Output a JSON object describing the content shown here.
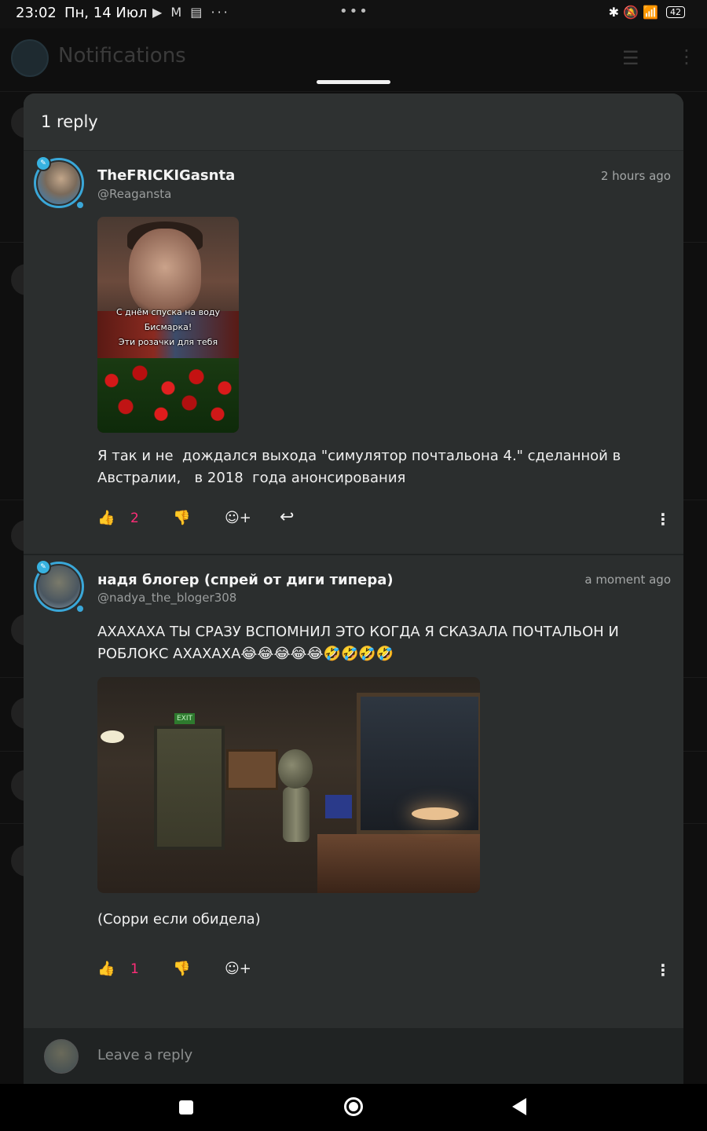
{
  "status_bar": {
    "time": "23:02",
    "date": "Пн, 14 Июл",
    "notif_icons": "▶ M ▤ ···",
    "center": "•••",
    "right_icons": "✱ 🔕 📶",
    "battery": "42"
  },
  "background_app": {
    "title": "Notifications"
  },
  "sheet": {
    "title": "1 reply"
  },
  "replies": [
    {
      "display_name": "TheFRICKIGasnta",
      "handle": "@Reagansta",
      "time": "2 hours ago",
      "image_caption": "С днём спуска на воду\nБисмарка!\nЭти розачки для тебя",
      "text": "Я так и не  дождался выхода \"симулятор почтальона 4.\" сделанной в Австралии,   в 2018  года анонсирования",
      "likes": "2"
    },
    {
      "display_name": "надя блогер (спрей от диги типера)",
      "handle": "@nadya_the_bloger308",
      "time": "a moment ago",
      "text": "АХАХАХА ТЫ СРАЗУ ВСПОМНИЛ ЭТО КОГДА Я СКАЗАЛА ПОЧТАЛЬОН И РОБЛОКС АХАХАХА😂😂😂😂😂🤣🤣🤣🤣",
      "image_sign": "EXIT",
      "text2": "(Сорри если обидела)",
      "likes": "1"
    }
  ],
  "reply_input": {
    "placeholder": "Leave a reply"
  },
  "colors": {
    "accent_like": "#ff2d78",
    "avatar_ring": "#3aa7d8",
    "sheet_bg": "#2b2e2e"
  }
}
